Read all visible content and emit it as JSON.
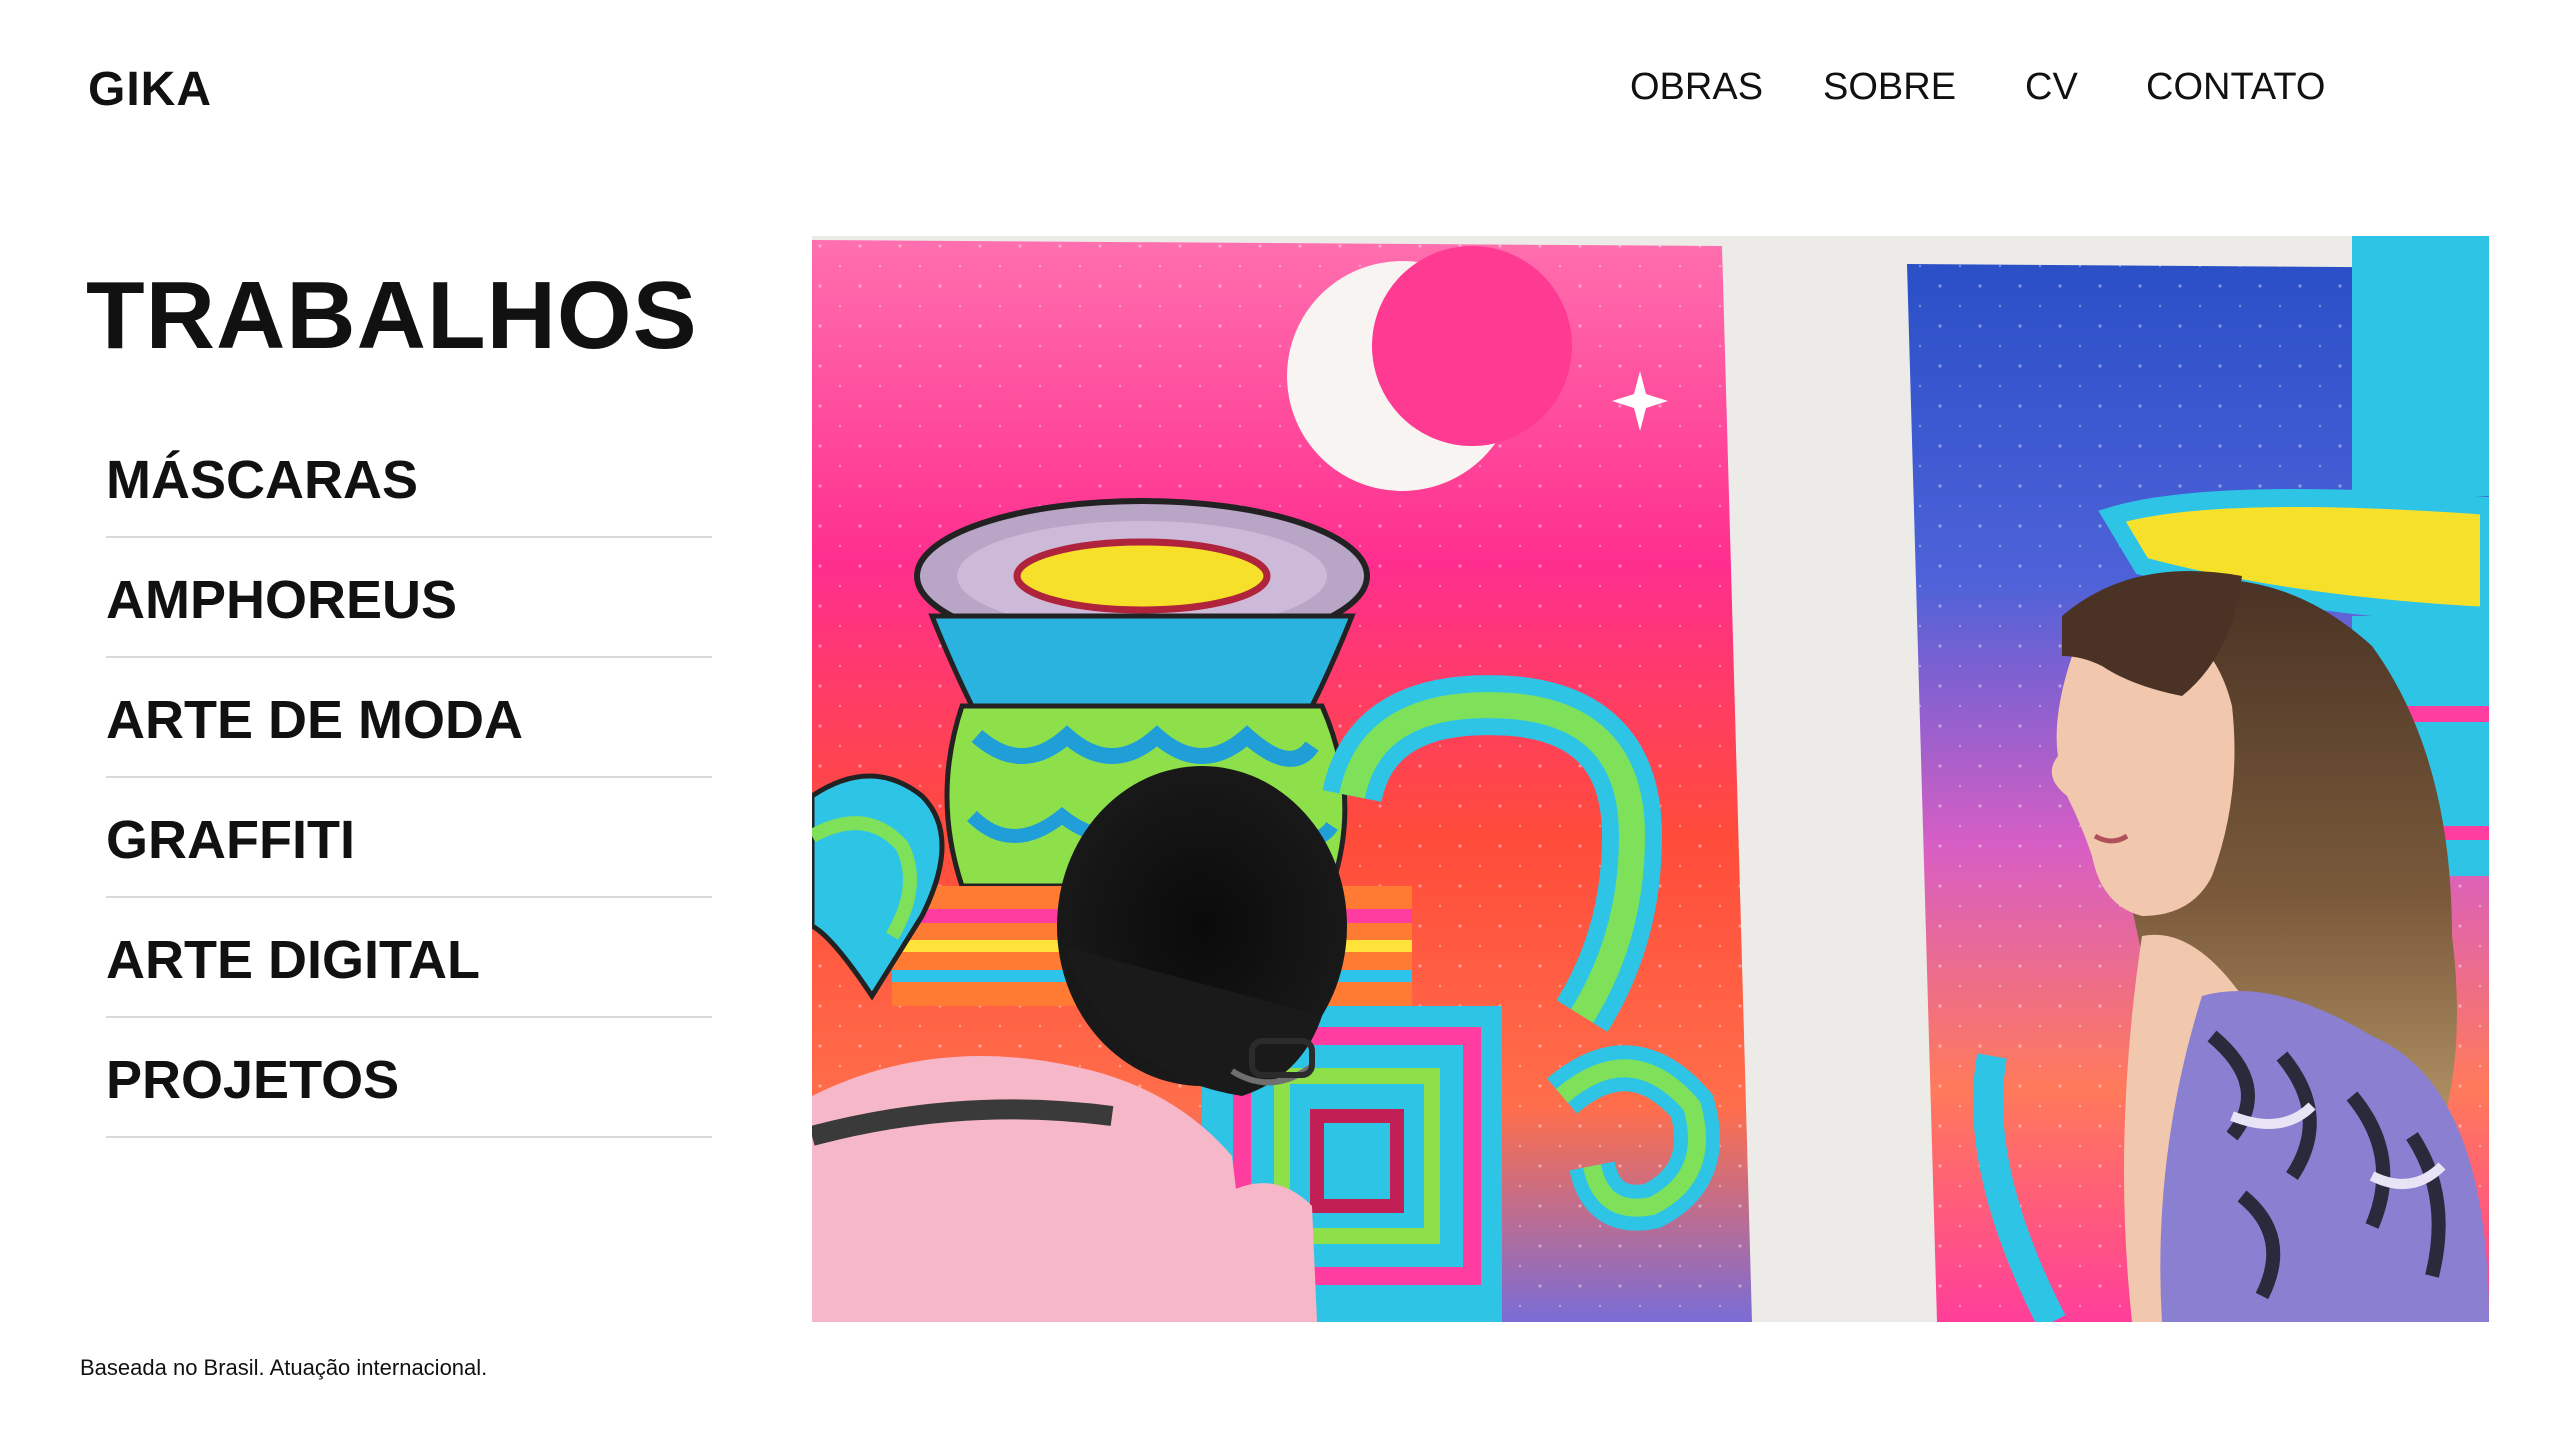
{
  "brand": {
    "logo": "GIKA"
  },
  "nav": {
    "items": [
      {
        "label": "OBRAS"
      },
      {
        "label": "SOBRE"
      },
      {
        "label": "CV"
      },
      {
        "label": "CONTATO"
      }
    ]
  },
  "main": {
    "title": "TRABALHOS",
    "categories": [
      {
        "label": "MÁSCARAS"
      },
      {
        "label": "AMPHOREUS"
      },
      {
        "label": "ARTE DE MODA"
      },
      {
        "label": "GRAFFITI"
      },
      {
        "label": "ARTE DIGITAL"
      },
      {
        "label": "PROJETOS"
      }
    ]
  },
  "footer": {
    "note": "Baseada no Brasil. Atuação internacional."
  },
  "colors": {
    "background": "#ffffff",
    "text": "#111111",
    "divider": "#d9d9d9"
  }
}
